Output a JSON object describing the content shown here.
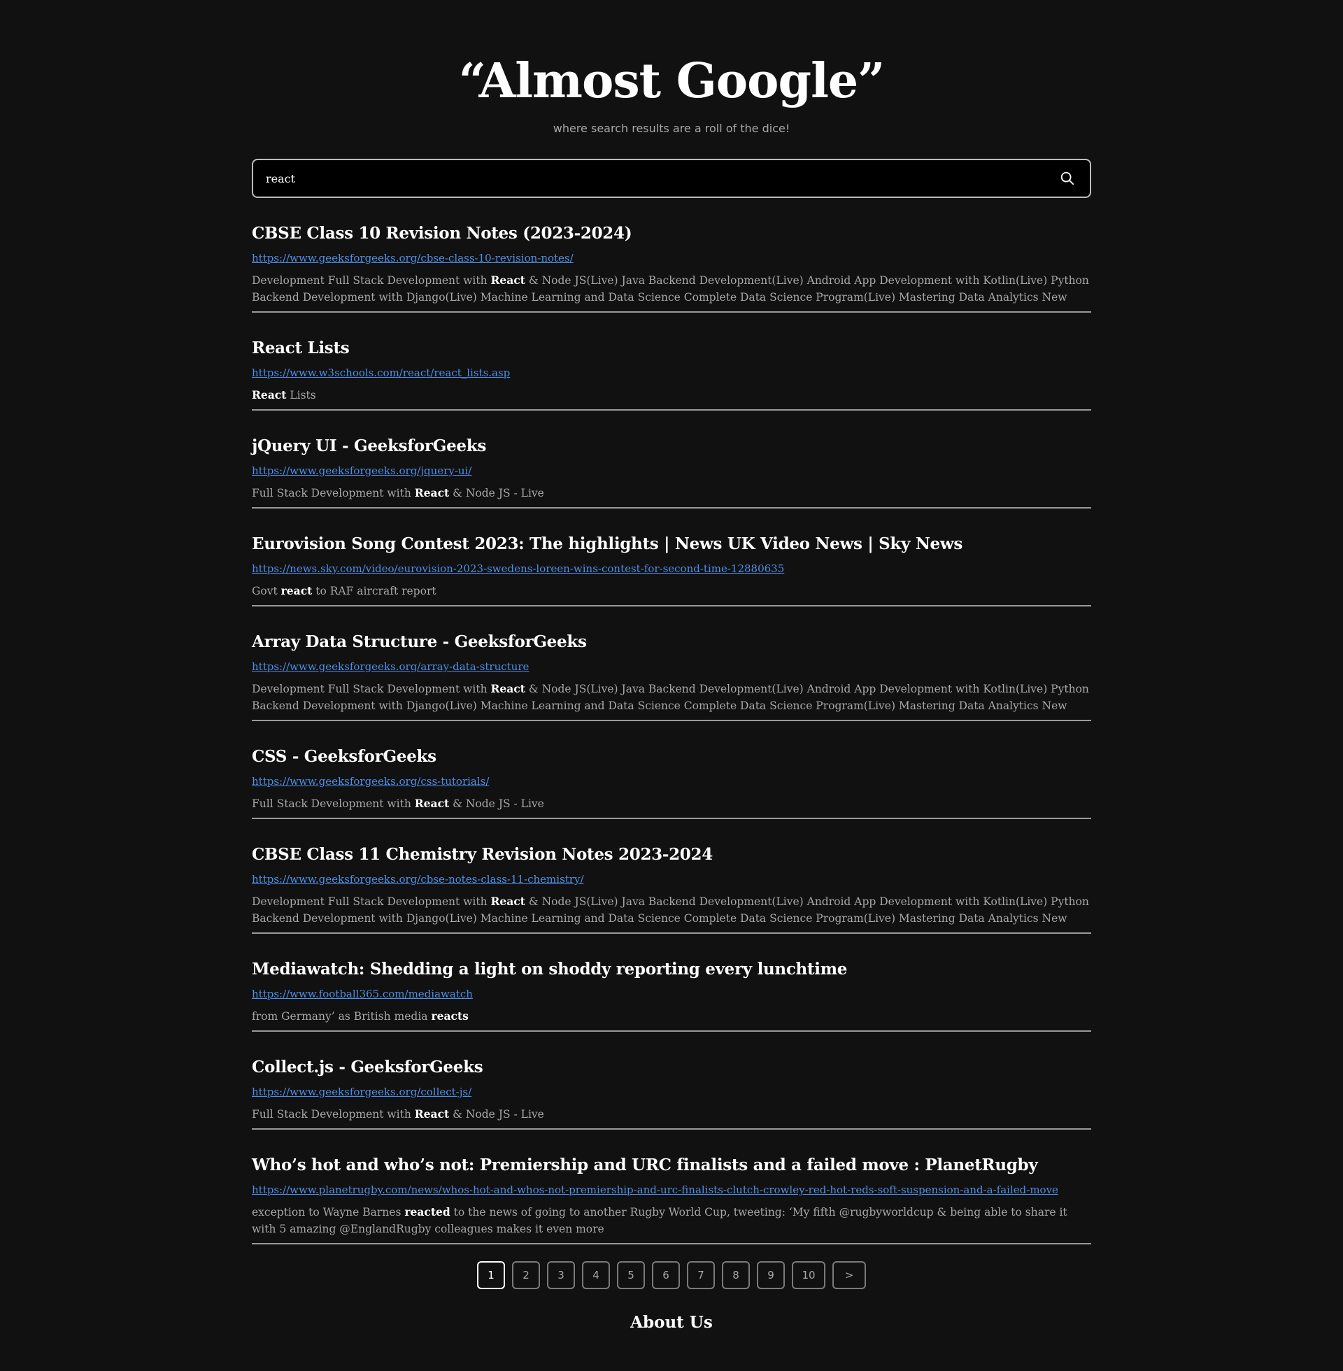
{
  "header": {
    "title": "“Almost Google”",
    "tagline": "where search results are a roll of the dice!"
  },
  "search": {
    "value": "react",
    "icon": "search-icon"
  },
  "results": [
    {
      "title": "CBSE Class 10 Revision Notes (2023-2024)",
      "url": "https://www.geeksforgeeks.org/cbse-class-10-revision-notes/",
      "snippet": [
        {
          "text": "Development Full Stack Development with ",
          "bold": false
        },
        {
          "text": "React",
          "bold": true
        },
        {
          "text": " & Node JS(Live) Java Backend Development(Live) Android App Development with Kotlin(Live) Python Backend Development with Django(Live) Machine Learning and Data Science Complete Data Science Program(Live) Mastering Data Analytics New",
          "bold": false
        }
      ]
    },
    {
      "title": "React Lists",
      "url": "https://www.w3schools.com/react/react_lists.asp",
      "snippet": [
        {
          "text": "React",
          "bold": true
        },
        {
          "text": " Lists",
          "bold": false
        }
      ]
    },
    {
      "title": "jQuery UI - GeeksforGeeks",
      "url": "https://www.geeksforgeeks.org/jquery-ui/",
      "snippet": [
        {
          "text": "Full Stack Development with ",
          "bold": false
        },
        {
          "text": "React",
          "bold": true
        },
        {
          "text": " & Node JS - Live",
          "bold": false
        }
      ]
    },
    {
      "title": "Eurovision Song Contest 2023: The highlights | News UK Video News | Sky News",
      "url": "https://news.sky.com/video/eurovision-2023-swedens-loreen-wins-contest-for-second-time-12880635",
      "snippet": [
        {
          "text": "Govt ",
          "bold": false
        },
        {
          "text": "react",
          "bold": true
        },
        {
          "text": " to RAF aircraft report",
          "bold": false
        }
      ]
    },
    {
      "title": "Array Data Structure - GeeksforGeeks",
      "url": "https://www.geeksforgeeks.org/array-data-structure",
      "snippet": [
        {
          "text": "Development Full Stack Development with ",
          "bold": false
        },
        {
          "text": "React",
          "bold": true
        },
        {
          "text": " & Node JS(Live) Java Backend Development(Live) Android App Development with Kotlin(Live) Python Backend Development with Django(Live) Machine Learning and Data Science Complete Data Science Program(Live) Mastering Data Analytics New",
          "bold": false
        }
      ]
    },
    {
      "title": "CSS - GeeksforGeeks",
      "url": "https://www.geeksforgeeks.org/css-tutorials/",
      "snippet": [
        {
          "text": "Full Stack Development with ",
          "bold": false
        },
        {
          "text": "React",
          "bold": true
        },
        {
          "text": " & Node JS - Live",
          "bold": false
        }
      ]
    },
    {
      "title": "CBSE Class 11 Chemistry Revision Notes 2023-2024",
      "url": "https://www.geeksforgeeks.org/cbse-notes-class-11-chemistry/",
      "snippet": [
        {
          "text": "Development Full Stack Development with ",
          "bold": false
        },
        {
          "text": "React",
          "bold": true
        },
        {
          "text": " & Node JS(Live) Java Backend Development(Live) Android App Development with Kotlin(Live) Python Backend Development with Django(Live) Machine Learning and Data Science Complete Data Science Program(Live) Mastering Data Analytics New",
          "bold": false
        }
      ]
    },
    {
      "title": "Mediawatch: Shedding a light on shoddy reporting every lunchtime",
      "url": "https://www.football365.com/mediawatch",
      "snippet": [
        {
          "text": "from Germany’ as British media ",
          "bold": false
        },
        {
          "text": "reacts",
          "bold": true
        }
      ]
    },
    {
      "title": "Collect.js - GeeksforGeeks",
      "url": "https://www.geeksforgeeks.org/collect-js/",
      "snippet": [
        {
          "text": "Full Stack Development with ",
          "bold": false
        },
        {
          "text": "React",
          "bold": true
        },
        {
          "text": " & Node JS - Live",
          "bold": false
        }
      ]
    },
    {
      "title": "Who’s hot and who’s not: Premiership and URC finalists and a failed move : PlanetRugby",
      "url": "https://www.planetrugby.com/news/whos-hot-and-whos-not-premiership-and-urc-finalists-clutch-crowley-red-hot-reds-soft-suspension-and-a-failed-move",
      "snippet": [
        {
          "text": "exception to Wayne Barnes ",
          "bold": false
        },
        {
          "text": "reacted",
          "bold": true
        },
        {
          "text": " to the news of going to another Rugby World Cup, tweeting: ‘My fifth @rugbyworldcup & being able to share it with 5 amazing @EnglandRugby colleagues makes it even more",
          "bold": false
        }
      ]
    }
  ],
  "pagination": {
    "pages": [
      "1",
      "2",
      "3",
      "4",
      "5",
      "6",
      "7",
      "8",
      "9",
      "10"
    ],
    "active": "1",
    "next_label": ">"
  },
  "footer": {
    "about_label": "About Us"
  }
}
